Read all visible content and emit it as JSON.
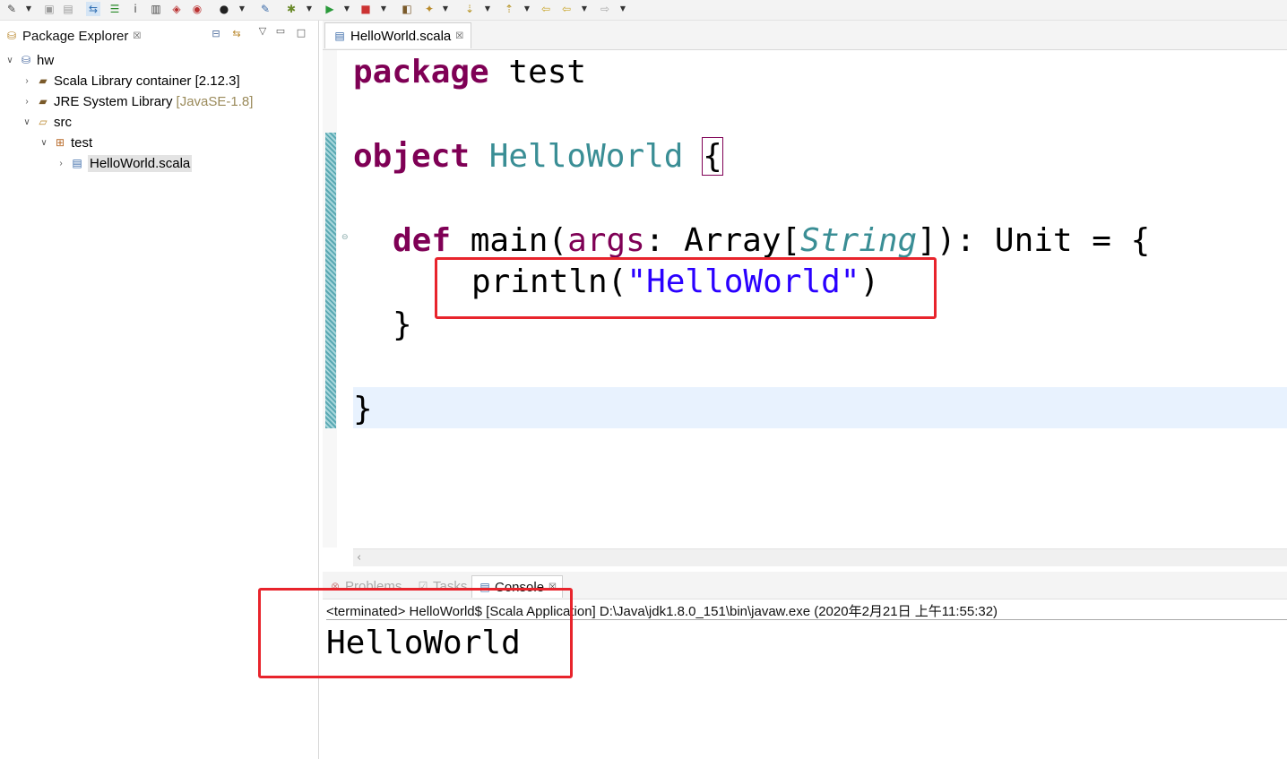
{
  "toolbar": {
    "icons": [
      "new-icon",
      "save-icon",
      "save-all-icon",
      "toggle-icon",
      "outline-icon",
      "info-icon",
      "doc-icon",
      "new-class-icon",
      "new-object-icon",
      "user-icon",
      "pin-icon",
      "debug-icon",
      "run-icon",
      "stop-icon",
      "open-type-icon",
      "search-icon",
      "next-annotation-icon",
      "prev-annotation-icon",
      "back-icon",
      "forward-icon"
    ]
  },
  "package_explorer": {
    "title": "Package Explorer",
    "close": "☒",
    "tree": [
      {
        "label": "hw",
        "decoration": ""
      },
      {
        "label": "Scala Library container [2.12.3]",
        "decoration": ""
      },
      {
        "label": "JRE System Library",
        "decoration": "[JavaSE-1.8]"
      },
      {
        "label": "src",
        "decoration": ""
      },
      {
        "label": "test",
        "decoration": ""
      },
      {
        "label": "HelloWorld.scala",
        "decoration": ""
      }
    ]
  },
  "editor": {
    "tab_label": "HelloWorld.scala",
    "tab_close": "☒",
    "code": {
      "l1_kw": "package",
      "l1_rest": " test",
      "l3_kw": "object",
      "l3_name": " HelloWorld",
      "l3_sp": " ",
      "l3_brace": "{",
      "l5_kw": "def",
      "l5_a": " main(",
      "l5_args": "args",
      "l5_b": ": Array[",
      "l5_string": "String",
      "l5_c": "]): Unit = {",
      "l6_a": "println(",
      "l6_str": "\"HelloWorld\"",
      "l6_b": ")",
      "l7": "}",
      "l9": "}"
    }
  },
  "bottom_panel": {
    "tabs": [
      "Problems",
      "Tasks",
      "Console"
    ],
    "console_close": "☒",
    "status": "<terminated> HelloWorld$ [Scala Application] D:\\Java\\jdk1.8.0_151\\bin\\javaw.exe (2020年2月21日 上午11:55:32)",
    "output": "HelloWorld"
  },
  "colors": {
    "annotation": "#e8242c",
    "keyword": "#7f0055",
    "string": "#2a00ff",
    "type": "#3a8e95"
  }
}
